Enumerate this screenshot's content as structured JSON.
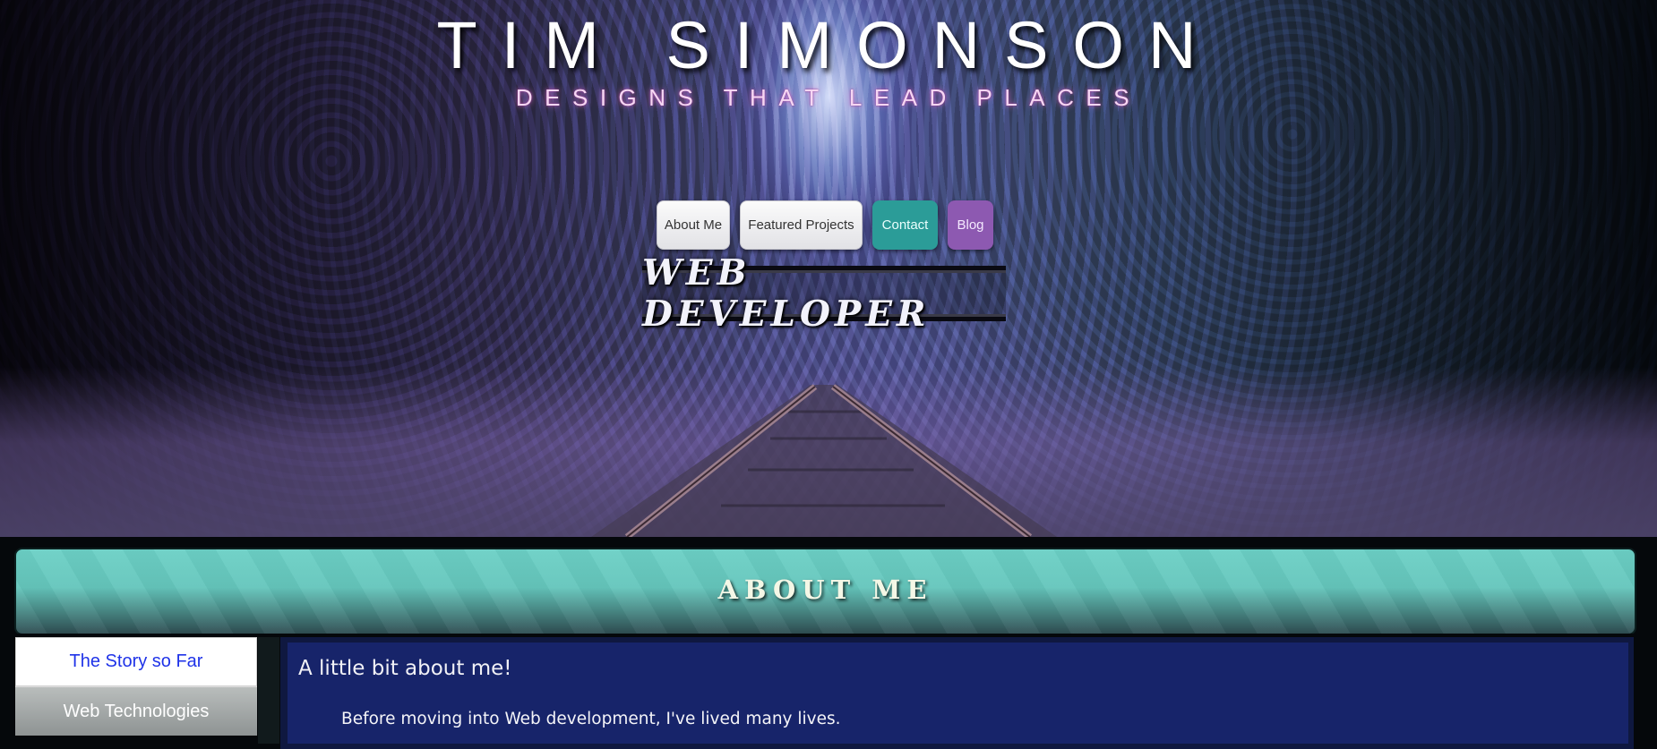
{
  "header": {
    "title": "TIM SIMONSON",
    "tagline": "DESIGNS THAT LEAD PLACES",
    "role": "WEB DEVELOPER"
  },
  "nav": {
    "items": [
      {
        "label": "About Me",
        "style": "light"
      },
      {
        "label": "Featured Projects",
        "style": "light"
      },
      {
        "label": "Contact",
        "style": "teal"
      },
      {
        "label": "Blog",
        "style": "purple"
      }
    ]
  },
  "about": {
    "title": "ABOUT ME",
    "tabs": [
      {
        "label": "The Story so Far",
        "active": true
      },
      {
        "label": "Web Technologies",
        "active": false
      }
    ],
    "heading": "A little bit about me!",
    "paragraph": "Before moving into Web development, I've lived many lives."
  },
  "colors": {
    "accent_teal": "#2b9c98",
    "accent_purple": "#8d59b1",
    "panel_teal": "#6cd0c6",
    "content_navy": "#17246a",
    "active_tab_text": "#1f33e8"
  }
}
